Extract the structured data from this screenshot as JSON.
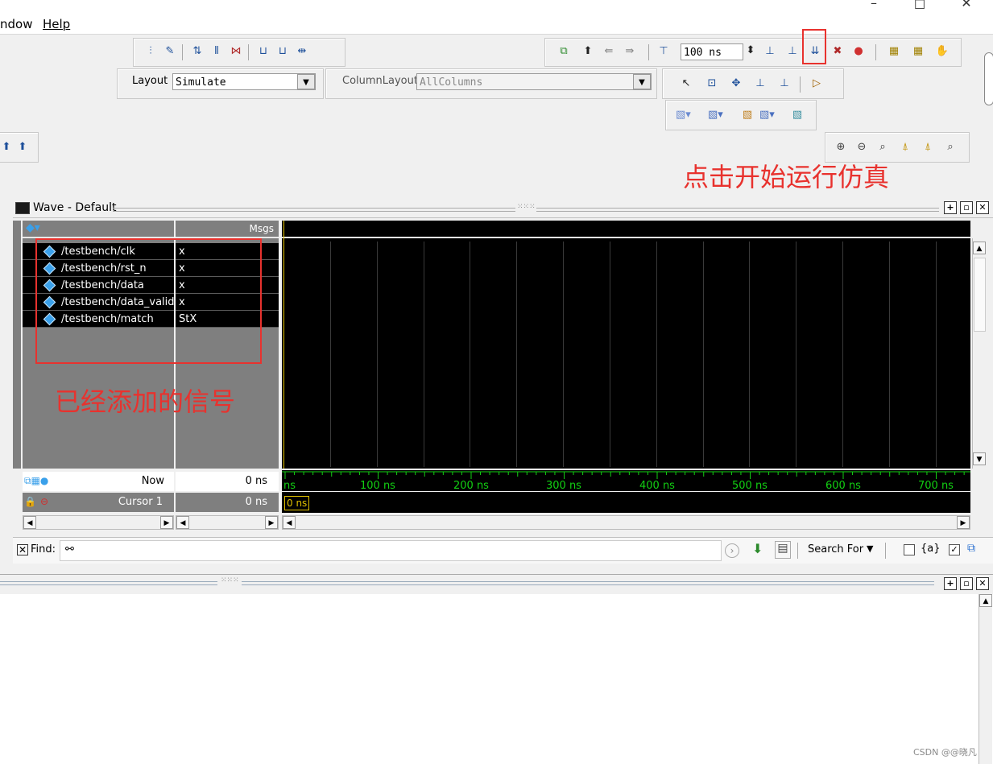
{
  "menu": {
    "window": "ndow",
    "help": "Help"
  },
  "toolbar": {
    "layout_label": "Layout",
    "layout_value": "Simulate",
    "column_layout_label": "ColumnLayout",
    "column_layout_value": "AllColumns",
    "run_length": "100 ns"
  },
  "wave": {
    "title": "Wave - Default",
    "msgs_header": "Msgs",
    "signals": [
      {
        "name": "/testbench/clk",
        "value": "x"
      },
      {
        "name": "/testbench/rst_n",
        "value": "x"
      },
      {
        "name": "/testbench/data",
        "value": "x"
      },
      {
        "name": "/testbench/data_valid",
        "value": "x"
      },
      {
        "name": "/testbench/match",
        "value": "StX"
      }
    ],
    "now_label": "Now",
    "now_value": "0 ns",
    "cursor_label": "Cursor 1",
    "cursor_value": "0 ns",
    "cursor_marker": "0 ns",
    "time_ticks": [
      "ns",
      "100 ns",
      "200 ns",
      "300 ns",
      "400 ns",
      "500 ns",
      "600 ns",
      "700 ns"
    ]
  },
  "find": {
    "label": "Find:",
    "search_for": "Search For",
    "regex": "{a}"
  },
  "annotations": {
    "start_sim": "点击开始运行仿真",
    "signals_added": "已经添加的信号"
  },
  "watermark": "CSDN @@晓凡",
  "colors": {
    "annotation": "#e8322e",
    "timeline": "#12d012",
    "signal_icon": "#3aa0ea"
  }
}
